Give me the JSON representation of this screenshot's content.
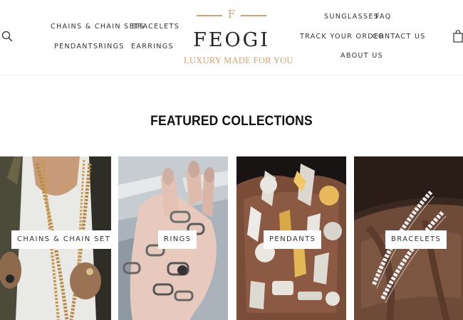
{
  "header": {
    "nav_left": {
      "chains": "CHAINS & CHAIN SETS",
      "bracelets": "BRACELETS",
      "pendants": "PENDANTS",
      "rings": "RINGS",
      "earrings": "EARRINGS"
    },
    "nav_right": {
      "sunglasses": "SUNGLASSES",
      "faq": "FAQ",
      "track_order": "TRACK YOUR ORDER",
      "contact": "CONTACT US",
      "about": "ABOUT US"
    },
    "logo": {
      "monogram": "F",
      "name": "FEOGI",
      "tagline": "LUXURY MADE FOR YOU"
    },
    "icons": {
      "search": "search-icon",
      "cart": "shopping-bag-icon"
    }
  },
  "featured": {
    "title": "FEATURED COLLECTIONS",
    "collections": [
      {
        "label": "CHAINS & CHAIN SETS"
      },
      {
        "label": "RINGS"
      },
      {
        "label": "PENDANTS"
      },
      {
        "label": "BRACELETS"
      }
    ]
  },
  "colors": {
    "accent_gold": "#d7a26c",
    "text": "#222222",
    "background": "#ffffff"
  }
}
